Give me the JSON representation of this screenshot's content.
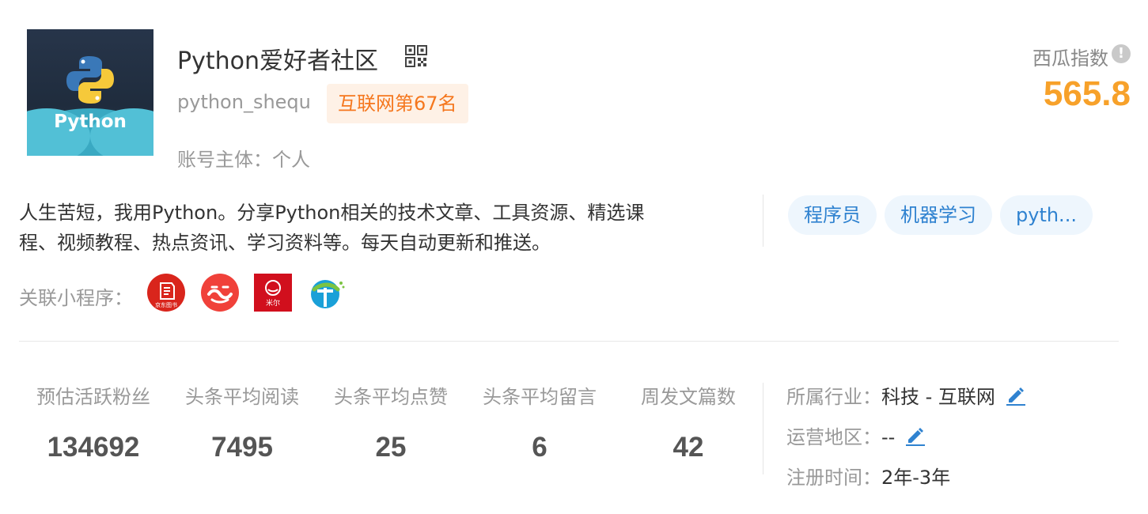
{
  "account": {
    "name": "Python爱好者社区",
    "handle": "python_shequ",
    "rank_badge": "互联网第67名",
    "entity": "账号主体：个人",
    "avatar_text": "Python"
  },
  "index": {
    "label": "西瓜指数",
    "value": "565.8",
    "info_icon": "!"
  },
  "description": {
    "line1": "人生苦短，我用Python。分享Python相关的技术文章、工具资源、精选课",
    "line2": "程、视频教程、热点资讯、学习资料等。每天自动更新和推送。"
  },
  "tags": [
    "程序员",
    "机器学习",
    "pyth..."
  ],
  "mini_programs": {
    "label": "关联小程序：",
    "items": [
      {
        "icon": "jd-books-icon",
        "caption": "京东图书"
      },
      {
        "icon": "dangdang-icon",
        "caption": "当当"
      },
      {
        "icon": "mini-red-icon",
        "caption": "米尔"
      },
      {
        "icon": "globe-icon",
        "caption": ""
      }
    ]
  },
  "stats": [
    {
      "label": "预估活跃粉丝",
      "value": "134692"
    },
    {
      "label": "头条平均阅读",
      "value": "7495"
    },
    {
      "label": "头条平均点赞",
      "value": "25"
    },
    {
      "label": "头条平均留言",
      "value": "6"
    },
    {
      "label": "周发文篇数",
      "value": "42"
    }
  ],
  "meta": {
    "industry_label": "所属行业：",
    "industry_value": "科技 - 互联网",
    "region_label": "运营地区：",
    "region_value": "--",
    "registered_label": "注册时间：",
    "registered_value": "2年-3年"
  },
  "colors": {
    "accent_orange": "#f7a12a",
    "badge_orange": "#f5771e",
    "tag_blue": "#2f82d0",
    "pencil_blue": "#2f82d0"
  }
}
